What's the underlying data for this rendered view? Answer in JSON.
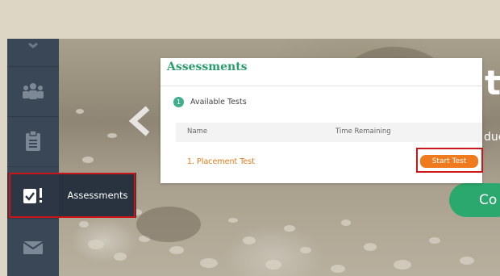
{
  "sidebar": {
    "items": [
      {
        "icon": "chevron-down-icon"
      },
      {
        "icon": "people-icon"
      },
      {
        "icon": "clipboard-icon"
      },
      {
        "icon": "assessment-icon",
        "label": "Assessments"
      },
      {
        "icon": "mail-icon"
      }
    ]
  },
  "panel": {
    "title": "Assessments",
    "section": {
      "badge": "1",
      "label": "Available Tests"
    },
    "columns": {
      "name": "Name",
      "time": "Time Remaining"
    },
    "rows": [
      {
        "name": "1. Placement Test",
        "action": "Start Test"
      }
    ]
  },
  "background": {
    "heading_fragment": "ts",
    "sub_fragment": "duc",
    "cta_fragment": "Co"
  },
  "colors": {
    "sidebar": "#3a4757",
    "accent_green": "#2a9d6c",
    "button_orange": "#f07a1e",
    "highlight_red": "#c8161b"
  }
}
